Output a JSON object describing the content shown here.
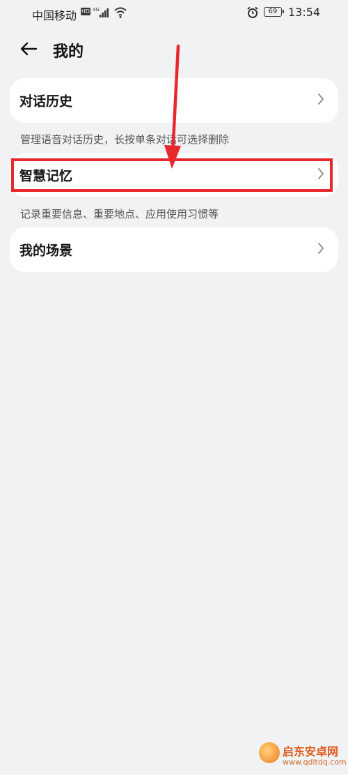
{
  "status_bar": {
    "carrier": "中国移动",
    "hd": "HD",
    "network": "4G",
    "battery": "69",
    "time": "13:54"
  },
  "header": {
    "title": "我的"
  },
  "menu": [
    {
      "label": "对话历史",
      "note": "管理语音对话历史，长按单条对话可选择删除"
    },
    {
      "label": "智慧记忆",
      "note": "记录重要信息、重要地点、应用使用习惯等"
    },
    {
      "label": "我的场景"
    }
  ],
  "annotation": {
    "color": "#e8282c",
    "highlighted_item": "智慧记忆"
  },
  "watermark": {
    "title": "启东安卓网",
    "url": "www.qdltdq.com"
  },
  "colors": {
    "background": "#f1f2f4",
    "card": "#ffffff"
  }
}
